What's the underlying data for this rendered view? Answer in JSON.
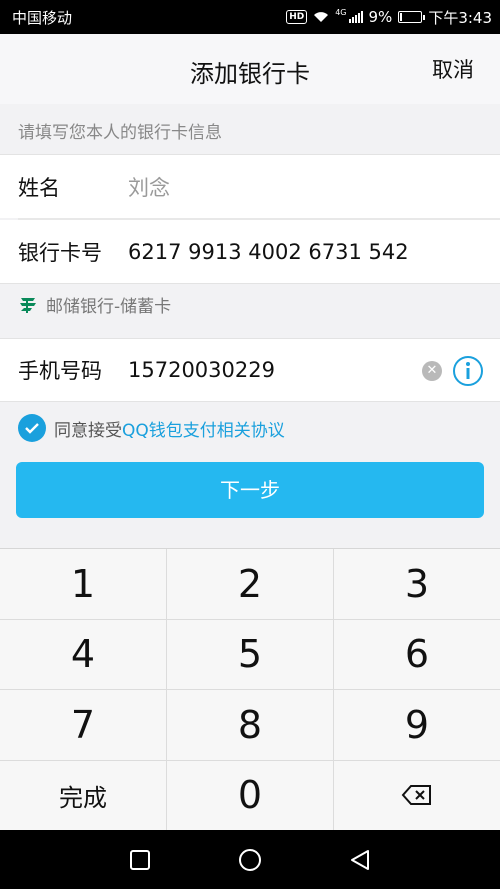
{
  "status_bar": {
    "carrier": "中国移动",
    "hd": "HD",
    "network": "4G",
    "battery": "9%",
    "battery_level": 0.09,
    "time": "下午3:43"
  },
  "header": {
    "title": "添加银行卡",
    "cancel": "取消"
  },
  "form": {
    "hint": "请填写您本人的银行卡信息",
    "name_label": "姓名",
    "name_value": "刘念",
    "card_label": "银行卡号",
    "card_value": "6217 9913 4002 6731 542",
    "bank_name": "邮储银行-储蓄卡",
    "phone_label": "手机号码",
    "phone_value": "15720030229"
  },
  "agreement": {
    "prefix": "同意接受",
    "link": "QQ钱包支付相关协议",
    "checked": true
  },
  "next_button": "下一步",
  "keypad": {
    "keys": [
      "1",
      "2",
      "3",
      "4",
      "5",
      "6",
      "7",
      "8",
      "9",
      "完成",
      "0",
      "backspace"
    ]
  },
  "colors": {
    "accent": "#25b8f0",
    "link": "#1aa0dd",
    "bank_green": "#0a8a5a"
  }
}
